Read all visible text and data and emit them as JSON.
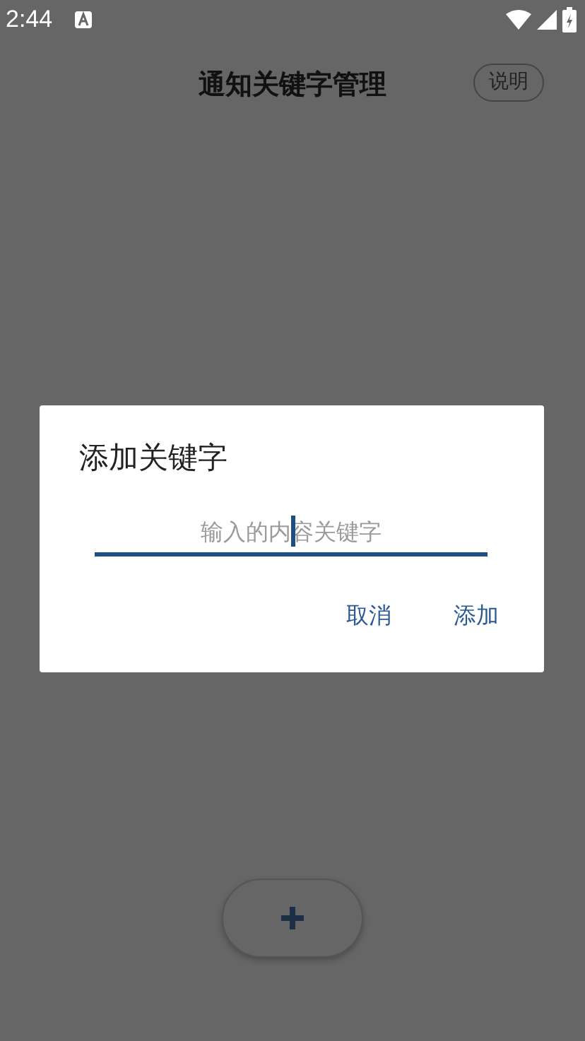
{
  "status_bar": {
    "time": "2:44"
  },
  "header": {
    "title": "通知关键字管理",
    "help_button": "说明"
  },
  "dialog": {
    "title": "添加关键字",
    "input": {
      "placeholder": "输入的内容关键字"
    },
    "buttons": [
      "取消",
      "添加"
    ]
  }
}
